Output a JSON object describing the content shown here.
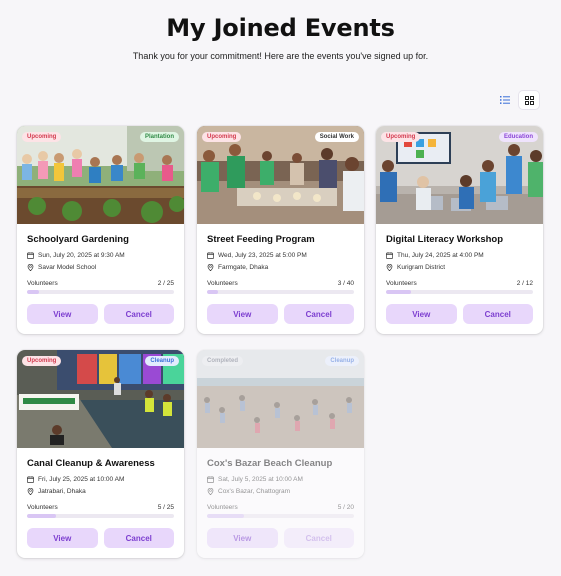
{
  "header": {
    "title": "My Joined Events",
    "subtitle": "Thank you for your commitment! Here are the events you've signed up for."
  },
  "view_toggle": {
    "list_icon": "list-icon",
    "grid_icon": "grid-icon",
    "active": "grid"
  },
  "labels": {
    "volunteers": "Volunteers",
    "view": "View",
    "cancel": "Cancel"
  },
  "events": [
    {
      "status": "Upcoming",
      "category": "Plantation",
      "category_bg": "#dff5e3",
      "category_color": "#2f8a45",
      "name": "Schoolyard Gardening",
      "date": "Sun, July 20, 2025 at 9:30 AM",
      "location": "Savar Model School",
      "volunteers": "2 / 25",
      "fill": 0.08
    },
    {
      "status": "Upcoming",
      "category": "Social Work",
      "category_bg": "#ffffff",
      "category_color": "#333333",
      "name": "Street Feeding Program",
      "date": "Wed, July 23, 2025 at 5:00 PM",
      "location": "Farmgate, Dhaka",
      "volunteers": "3 / 40",
      "fill": 0.075
    },
    {
      "status": "Upcoming",
      "category": "Education",
      "category_bg": "#efe3fd",
      "category_color": "#8a44d6",
      "name": "Digital Literacy Workshop",
      "date": "Thu, July 24, 2025 at 4:00 PM",
      "location": "Kurigram District",
      "volunteers": "2 / 12",
      "fill": 0.17
    },
    {
      "status": "Upcoming",
      "category": "Cleanup",
      "category_bg": "#e2ecfd",
      "category_color": "#3a6fd8",
      "name": "Canal Cleanup & Awareness",
      "date": "Fri, July 25, 2025 at 10:00 AM",
      "location": "Jatrabari, Dhaka",
      "volunteers": "5 / 25",
      "fill": 0.2
    },
    {
      "status": "Completed",
      "category": "Cleanup",
      "category_bg": "#e2ecfd",
      "category_color": "#3a6fd8",
      "name": "Cox's Bazar Beach Cleanup",
      "date": "Sat, July 5, 2025 at 10:00 AM",
      "location": "Cox's Bazar, Chattogram",
      "volunteers": "5 / 20",
      "fill": 0.25
    }
  ]
}
